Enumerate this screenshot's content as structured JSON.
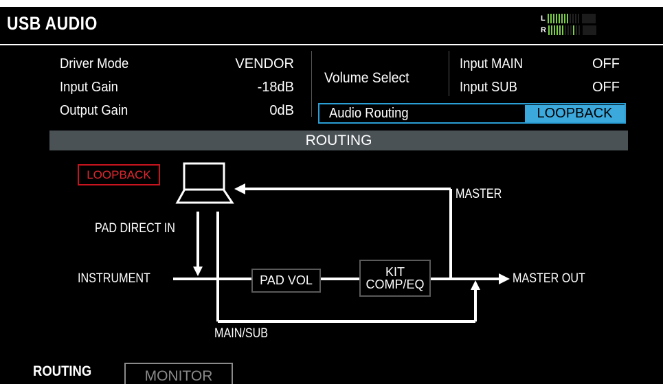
{
  "header": {
    "title": "USB AUDIO"
  },
  "level_meter": {
    "channels": [
      {
        "label": "L",
        "level": 0.67
      },
      {
        "label": "R",
        "level": 0.5,
        "peak": 0.75
      }
    ],
    "active_color": "#7bd04a"
  },
  "settings": {
    "rows": [
      {
        "label": "Driver Mode",
        "value": "VENDOR"
      },
      {
        "label": "Input Gain",
        "value": "-18dB"
      },
      {
        "label": "Output Gain",
        "value": "0dB"
      }
    ],
    "volume_select": {
      "label": "Volume Select",
      "inputs": [
        {
          "label": "Input MAIN",
          "value": "OFF"
        },
        {
          "label": "Input SUB",
          "value": "OFF"
        }
      ]
    },
    "audio_routing": {
      "label": "Audio Routing",
      "value": "LOOPBACK",
      "accent": "#3ca9dd"
    }
  },
  "section_title": "ROUTING",
  "diagram": {
    "mode_badge": "LOOPBACK",
    "badge_color": "#c8141e",
    "labels": {
      "pad_direct_in": "PAD DIRECT IN",
      "instrument": "INSTRUMENT",
      "master": "MASTER",
      "master_out": "MASTER OUT",
      "main_sub": "MAIN/SUB"
    },
    "blocks": {
      "pad_vol": "PAD VOL",
      "kit_line1": "KIT",
      "kit_line2": "COMP/EQ"
    },
    "computer_icon": "laptop-icon"
  },
  "tabs": [
    {
      "label": "ROUTING",
      "active": true
    },
    {
      "label": "MONITOR",
      "active": false
    }
  ]
}
